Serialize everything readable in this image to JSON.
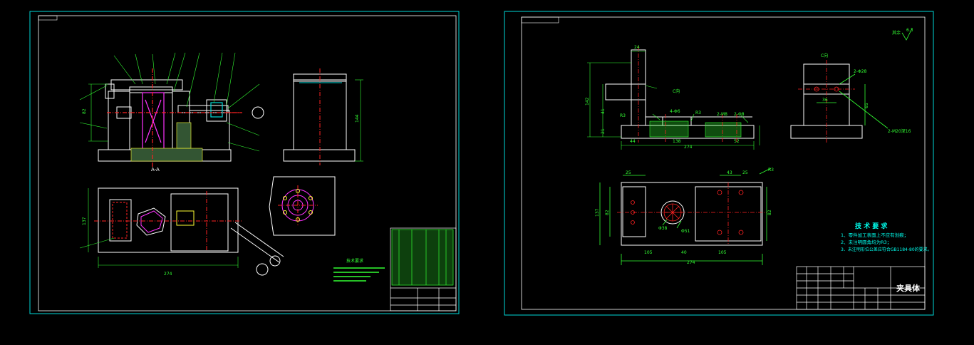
{
  "colors": {
    "background": "#000000",
    "frame": "#00d8d8",
    "part": "#ffffff",
    "dimension": "#33ff33",
    "centerline": "#ff2222",
    "highlight": "#ff33ff",
    "note": "#00eeff",
    "yellow": "#ffff33"
  },
  "left_sheet": {
    "section_label": "A-A",
    "dim_width": "274",
    "dim_side": "137",
    "dim_height_1": "82",
    "dim_height_2": "144",
    "tech_title": "技术要求"
  },
  "right_sheet": {
    "roughness_label": "其余",
    "roughness_value": "6.3",
    "front_view": {
      "d1": "24",
      "d2": "142",
      "d3": "41",
      "d4": "21",
      "d5": "44",
      "d6": "138",
      "d7": "274",
      "d8": "52",
      "hole1": "4-Φ6",
      "hole2": "2-M8",
      "hole3": "2-Φ8",
      "label_c": "C向",
      "r1": "R3",
      "r2": "R3"
    },
    "side_view": {
      "label": "C向",
      "hole": "2-Φ28",
      "thread": "2-M20深16",
      "d1": "36",
      "d2": "65"
    },
    "top_view": {
      "d1": "25",
      "d2": "43",
      "d3": "25",
      "d4": "137",
      "d5": "82",
      "d6": "105",
      "d7": "105",
      "d8": "40",
      "d9": "274",
      "d10": "Φ38",
      "d11": "Φ51",
      "d12": "R3"
    },
    "tech_notes": {
      "title": "技 术 要 求",
      "items": [
        "1、零件加工表面上不应有划痕；",
        "2、未注明圆角均为R3；",
        "3、未注明形位公差应符合GB1184-80的要求。"
      ]
    },
    "title_block_name": "夹具体"
  }
}
